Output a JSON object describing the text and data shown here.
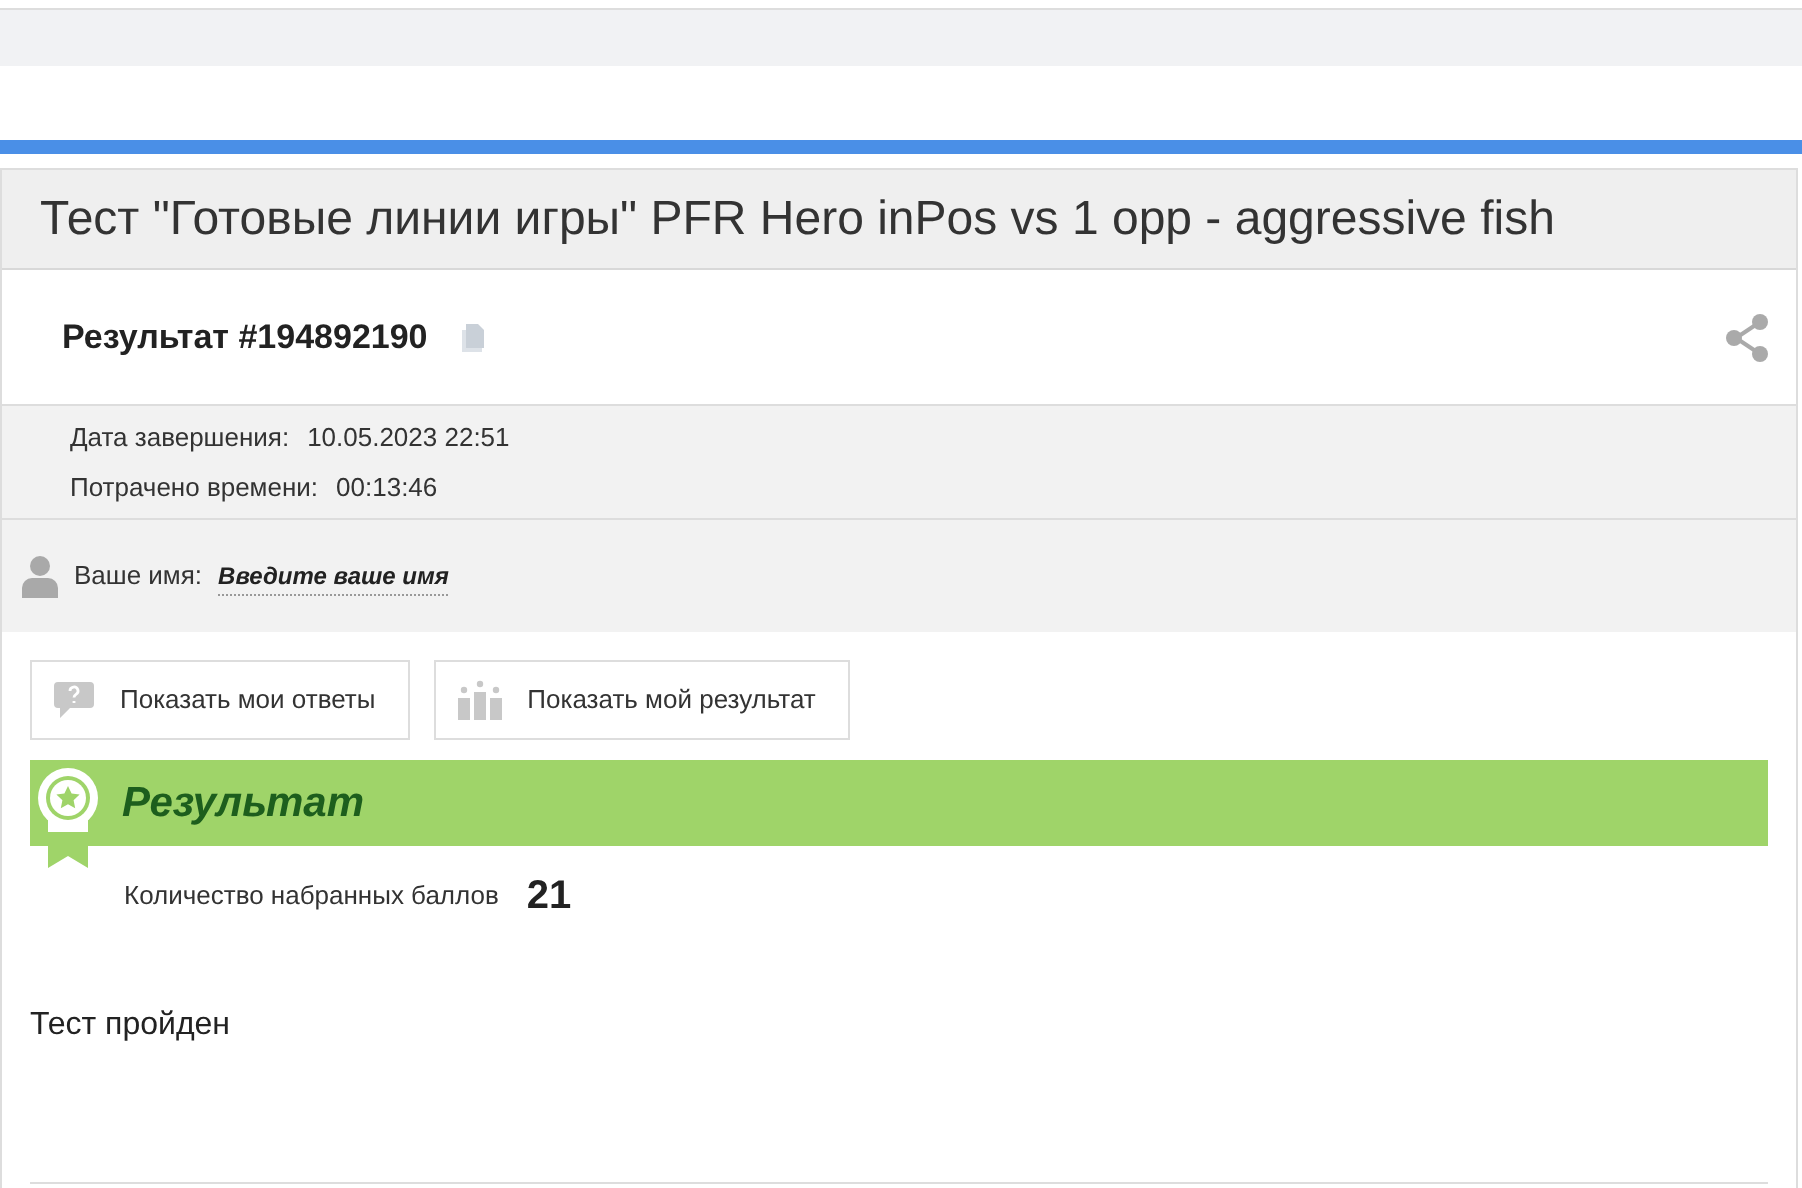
{
  "title": "Тест \"Готовые линии игры\" PFR Hero inPos vs 1 opp - aggressive fish",
  "result_heading": "Результат #194892190",
  "details": [
    {
      "label": "Дата завершения:",
      "value": "10.05.2023 22:51"
    },
    {
      "label": "Потрачено времени:",
      "value": "00:13:46"
    }
  ],
  "name_row": {
    "label": "Ваше имя:",
    "link": "Введите ваше имя"
  },
  "buttons": [
    {
      "kind": "answers",
      "label": "Показать мои ответы"
    },
    {
      "kind": "result",
      "label": "Показать мой результат"
    }
  ],
  "result_banner": {
    "title": "Результат"
  },
  "score": {
    "label": "Количество набранных баллов",
    "value": "21"
  },
  "verdict": "Тест пройден"
}
